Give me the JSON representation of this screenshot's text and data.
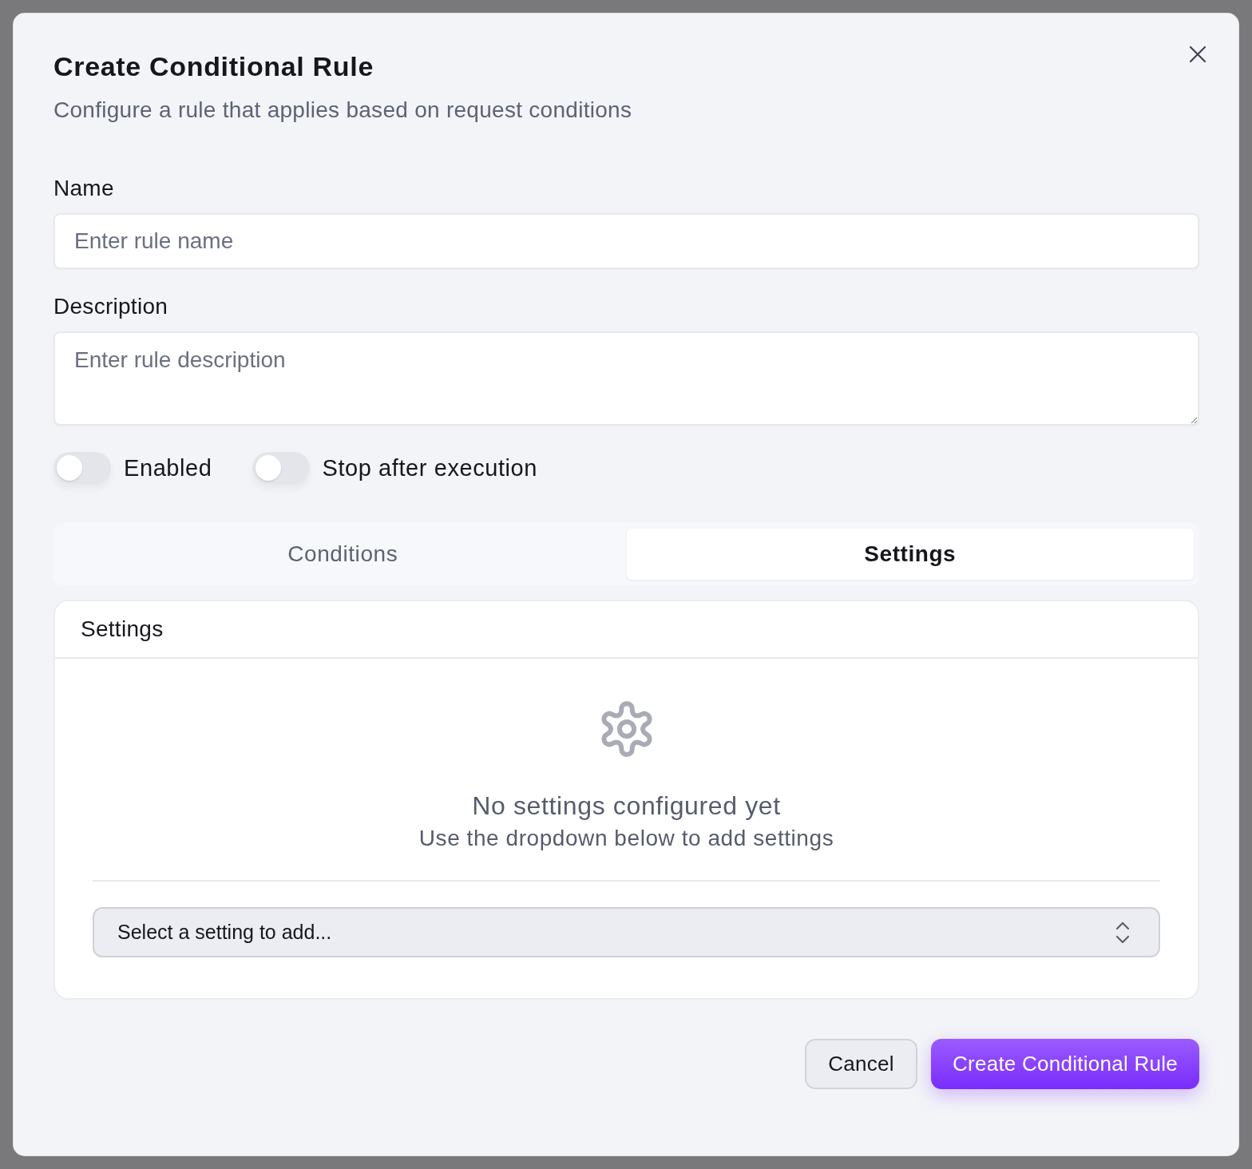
{
  "dialog": {
    "title": "Create Conditional Rule",
    "subtitle": "Configure a rule that applies based on request conditions"
  },
  "fields": [
    {
      "kind": "input",
      "label": "Name",
      "placeholder": "Enter rule name"
    },
    {
      "kind": "textarea",
      "label": "Description",
      "placeholder": "Enter rule description"
    }
  ],
  "toggles": [
    {
      "label": "Enabled",
      "on": false
    },
    {
      "label": "Stop after execution",
      "on": false
    }
  ],
  "tabs": [
    {
      "label": "Conditions",
      "selected": false
    },
    {
      "label": "Settings",
      "selected": true
    }
  ],
  "settings_panel": {
    "title": "Settings",
    "empty_title": "No settings configured yet",
    "empty_hint": "Use the dropdown below to add settings",
    "setting_select": {
      "placeholder": "Select a setting to add..."
    }
  },
  "buttons": [
    {
      "kind": "secondary",
      "label": "Cancel"
    },
    {
      "kind": "primary",
      "label": "Create Conditional Rule"
    }
  ]
}
